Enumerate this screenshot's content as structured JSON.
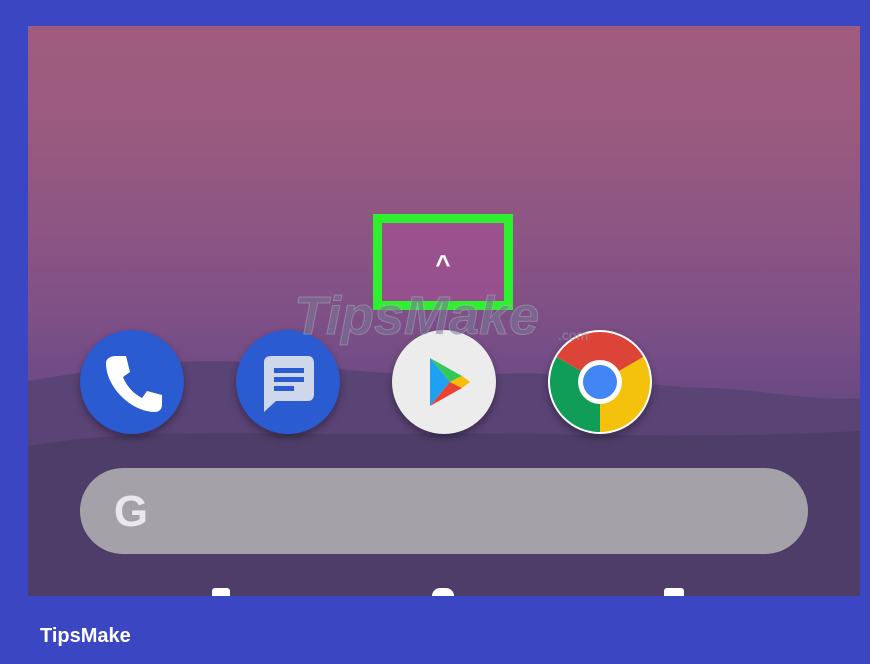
{
  "screen": {
    "up_arrow_symbol": "^",
    "watermark_text": "TipsMake",
    "watermark_suffix": ".com"
  },
  "dock": {
    "apps": [
      {
        "icon": "phone-icon"
      },
      {
        "icon": "messages-icon"
      },
      {
        "icon": "play-store-icon"
      },
      {
        "icon": "chrome-icon"
      }
    ]
  },
  "search": {
    "logo_letter": "G"
  },
  "footer": {
    "brand": "TipsMake"
  },
  "colors": {
    "frame": "#3b46c2",
    "highlight": "#2ef02e",
    "phone_app": "#2a5bd0",
    "search_bar": "#a5a1a8"
  }
}
